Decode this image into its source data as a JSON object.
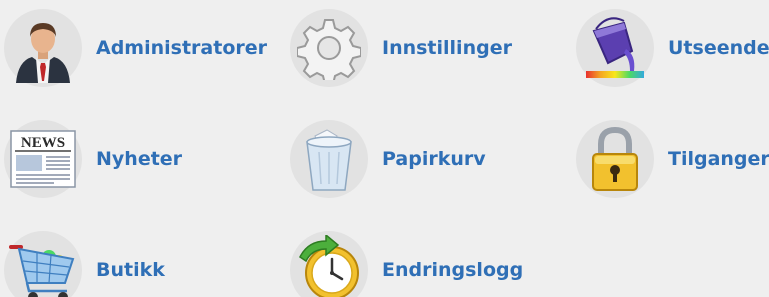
{
  "tiles": [
    {
      "label": "Administratorer",
      "icon": "admin-user-icon"
    },
    {
      "label": "Innstillinger",
      "icon": "gear-icon"
    },
    {
      "label": "Utseende",
      "icon": "paint-bucket-icon"
    },
    {
      "label": "Nyheter",
      "icon": "newspaper-icon"
    },
    {
      "label": "Papirkurv",
      "icon": "recycle-bin-icon"
    },
    {
      "label": "Tilganger",
      "icon": "padlock-icon"
    },
    {
      "label": "Butikk",
      "icon": "shopping-cart-icon"
    },
    {
      "label": "Endringslogg",
      "icon": "history-clock-icon"
    }
  ],
  "icon_text": {
    "news_masthead": "NEWS"
  },
  "colors": {
    "background": "#efefef",
    "icon_circle": "#e2e2e2",
    "link_text": "#2f6fb6"
  }
}
